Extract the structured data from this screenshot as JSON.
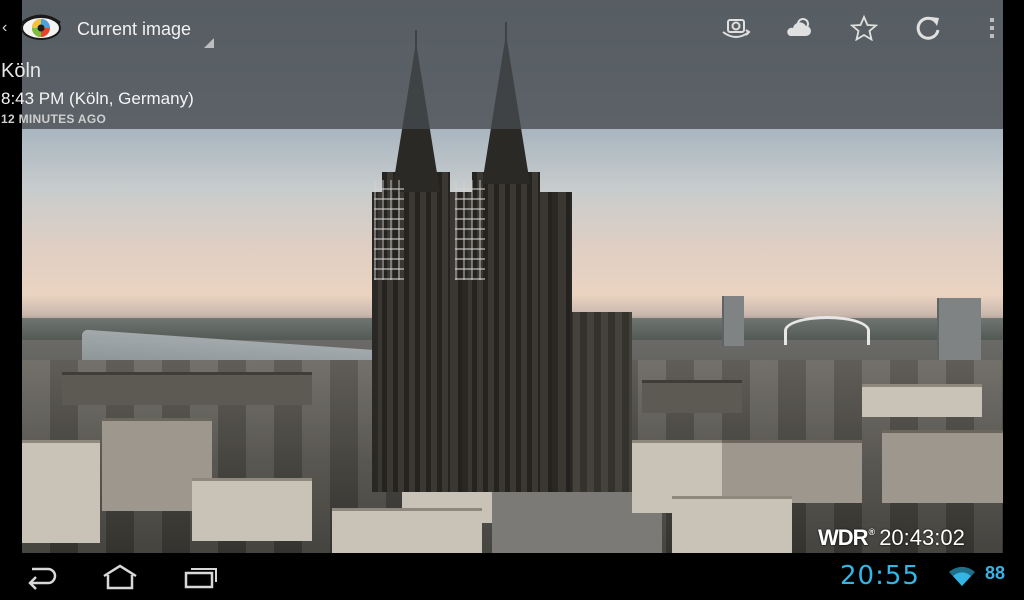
{
  "app": {
    "icon": "eye-icon",
    "view_selector_label": "Current image"
  },
  "actions": [
    {
      "name": "camera-switch-icon"
    },
    {
      "name": "weather-icon"
    },
    {
      "name": "favorite-star-icon"
    },
    {
      "name": "refresh-icon"
    },
    {
      "name": "overflow-menu-icon"
    }
  ],
  "webcam": {
    "city": "Köln",
    "local_time": "8:43 PM (Köln, Germany)",
    "updated_ago": "12 MINUTES AGO",
    "watermark_logo": "WDR",
    "watermark_reg": "®",
    "watermark_time": "20:43:02"
  },
  "system_bar": {
    "clock": "20:55",
    "battery_level": "88",
    "accent_color": "#33b5e5",
    "nav": [
      "back-icon",
      "home-icon",
      "recent-apps-icon"
    ]
  }
}
